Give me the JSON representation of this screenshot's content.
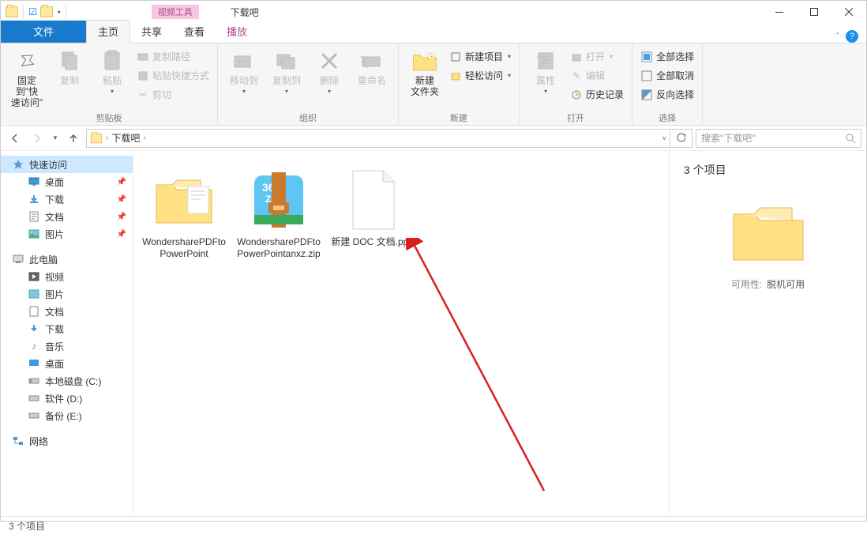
{
  "titlebar": {
    "context_tool": "视频工具",
    "app_title": "下载吧"
  },
  "tabs": {
    "file": "文件",
    "home": "主页",
    "share": "共享",
    "view": "查看",
    "play": "播放"
  },
  "ribbon": {
    "clipboard": {
      "pin": "固定到\"快\n速访问\"",
      "copy": "复制",
      "paste": "粘贴",
      "copy_path": "复制路径",
      "paste_shortcut": "粘贴快捷方式",
      "cut": "剪切",
      "title": "剪贴板"
    },
    "organize": {
      "move_to": "移动到",
      "copy_to": "复制到",
      "delete": "删除",
      "rename": "重命名",
      "title": "组织"
    },
    "new": {
      "new_folder": "新建\n文件夹",
      "new_item": "新建项目",
      "easy_access": "轻松访问",
      "title": "新建"
    },
    "open": {
      "properties": "属性",
      "open": "打开",
      "edit": "编辑",
      "history": "历史记录",
      "title": "打开"
    },
    "select": {
      "select_all": "全部选择",
      "select_none": "全部取消",
      "invert": "反向选择",
      "title": "选择"
    }
  },
  "address": {
    "crumb1": "下载吧",
    "refresh_hint": "刷新",
    "search_placeholder": "搜索\"下载吧\""
  },
  "sidebar": {
    "quick_access": "快速访问",
    "desktop": "桌面",
    "downloads": "下载",
    "documents": "文档",
    "pictures": "图片",
    "this_pc": "此电脑",
    "videos": "视频",
    "pictures2": "图片",
    "documents2": "文档",
    "downloads2": "下载",
    "music": "音乐",
    "desktop2": "桌面",
    "disk_c": "本地磁盘 (C:)",
    "disk_d": "软件 (D:)",
    "disk_e": "备份 (E:)",
    "network": "网络"
  },
  "files": [
    {
      "name": "WondersharePDFtoPowerPoint"
    },
    {
      "name": "WondersharePDFtoPowerPointanxz.zip"
    },
    {
      "name": "新建 DOC 文档.pptx"
    }
  ],
  "details": {
    "count": "3 个项目",
    "avail_k": "可用性:",
    "avail_v": "脱机可用"
  },
  "status": {
    "text": "3 个项目"
  }
}
